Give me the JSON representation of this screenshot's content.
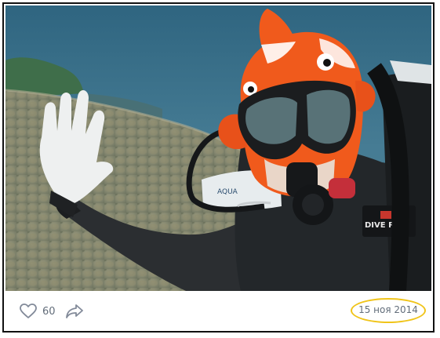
{
  "post": {
    "photo_alt": "Scuba diver wearing a clownfish costume hood waving underwater",
    "regulator_brand": "DIVE RITE",
    "bcd_brand": "AQUA"
  },
  "footer": {
    "like_icon": "heart-outline-icon",
    "like_count": "60",
    "share_icon": "share-arrow-icon",
    "date": "15 ноя 2014",
    "date_highlight_color": "#f0c419"
  },
  "colors": {
    "text_muted": "#626d7a",
    "border": "#111111",
    "water": "#3d6d86",
    "costume_orange": "#f05a1c"
  }
}
